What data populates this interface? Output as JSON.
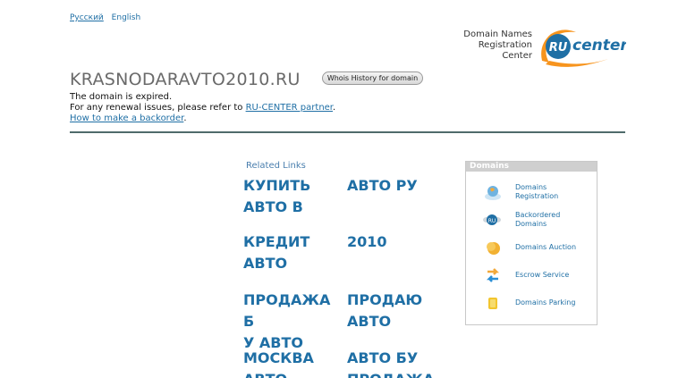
{
  "language": {
    "russian": "Русский",
    "english": "English"
  },
  "registrar": {
    "line1": "Domain Names",
    "line2": "Registration",
    "line3": "Center",
    "logo_text_ru": "RU",
    "logo_text_center": "center"
  },
  "domain": {
    "name": "KRASNODARAVTO2010.RU",
    "whois_button": "Whois History for domain",
    "expired": "The domain is expired.",
    "renewal_prefix": "For any renewal issues, please refer to ",
    "renewal_link": "RU-CENTER partner",
    "renewal_suffix": ".",
    "backorder_link": "How to make a backorder",
    "backorder_suffix": "."
  },
  "related": {
    "title": "Related Links",
    "links": [
      [
        "КУПИТЬ",
        "АВТО В"
      ],
      [
        "АВТО РУ"
      ],
      [
        "КРЕДИТ",
        "АВТО"
      ],
      [
        "2010"
      ],
      [
        "ПРОДАЖА Б",
        "У АВТО"
      ],
      [
        "ПРОДАЮ",
        "АВТО"
      ],
      [
        "МОСКВА",
        "АВТО"
      ],
      [
        "АВТО БУ",
        "ПРОДАЖА"
      ]
    ]
  },
  "domains_panel": {
    "title": "Domains",
    "items": [
      {
        "label1": "Domains",
        "label2": "Registration",
        "icon": "globe-icon"
      },
      {
        "label1": "Backordered",
        "label2": "Domains",
        "icon": "ru-wings-icon"
      },
      {
        "label1": "Domains Auction",
        "label2": "",
        "icon": "coins-icon"
      },
      {
        "label1": "Escrow Service",
        "label2": "",
        "icon": "exchange-arrows-icon"
      },
      {
        "label1": "Domains Parking",
        "label2": "",
        "icon": "parking-coin-icon"
      }
    ]
  },
  "colors": {
    "link": "#1f6fa5",
    "logo_orange": "#f7941d",
    "logo_blue": "#1f6fa5"
  }
}
